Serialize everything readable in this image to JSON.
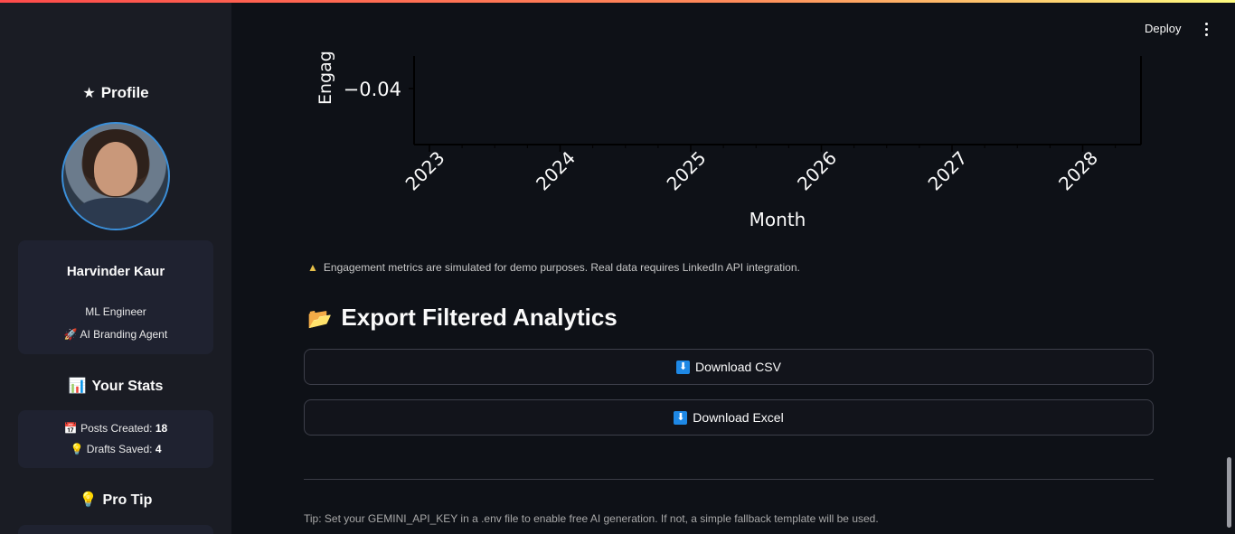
{
  "sidebar": {
    "profile_title": "Profile",
    "profile_icon": "star-icon",
    "name": "Harvinder Kaur",
    "role": "ML Engineer",
    "agent_label": "AI Branding Agent",
    "stats_title": "Your Stats",
    "posts_label": "Posts Created:",
    "posts_value": "18",
    "drafts_label": "Drafts Saved:",
    "drafts_value": "4",
    "protip_title": "Pro Tip"
  },
  "header": {
    "deploy_label": "Deploy"
  },
  "chart_data": {
    "type": "line",
    "ylabel": "Engag",
    "xlabel": "Month",
    "y_tick_labels": [
      "−0.04"
    ],
    "x_tick_labels": [
      "2023",
      "2024",
      "2025",
      "2026",
      "2027",
      "2028"
    ]
  },
  "main": {
    "warning_text": "Engagement metrics are simulated for demo purposes. Real data requires LinkedIn API integration.",
    "export_title": "Export Filtered Analytics",
    "download_csv": "Download CSV",
    "download_excel": "Download Excel",
    "tip_text": "Tip: Set your GEMINI_API_KEY in a .env file to enable free AI generation. If not, a simple fallback template will be used."
  },
  "colors": {
    "accent": "#ff4b4b",
    "button_icon": "#1e88e5",
    "avatar_border": "#3b8fd9"
  }
}
